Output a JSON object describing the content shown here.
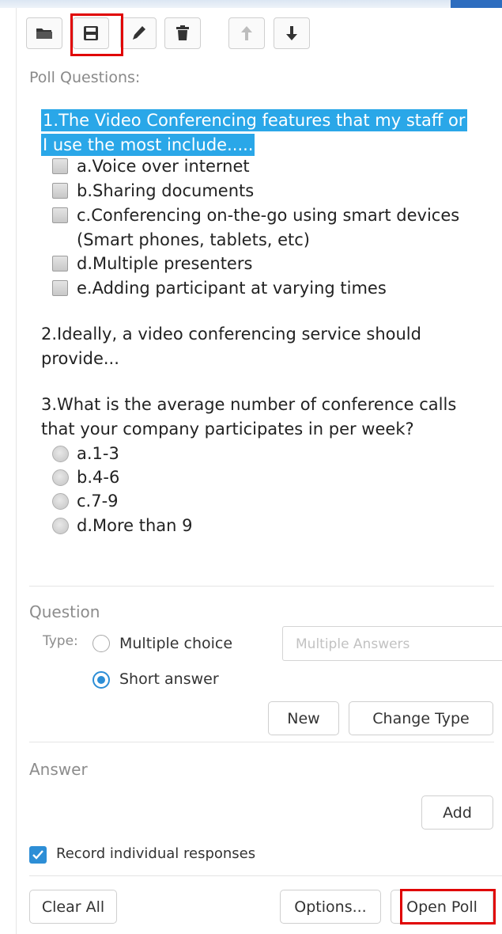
{
  "toolbar": {
    "icons": [
      "folder-open-icon",
      "save-icon",
      "pencil-icon",
      "trash-icon",
      "arrow-up-icon",
      "arrow-down-icon"
    ]
  },
  "poll": {
    "label": "Poll Questions:",
    "q1": {
      "text": "1.The Video Conferencing features that my staff or I use the most include.....",
      "options": [
        "a.Voice over internet",
        "b.Sharing documents",
        "c.Conferencing on-the-go using smart devices",
        "(Smart phones, tablets, etc)",
        "d.Multiple presenters",
        "e.Adding participant at varying times"
      ]
    },
    "q2": {
      "line1": "2.Ideally, a video conferencing service should",
      "line2": "provide..."
    },
    "q3": {
      "line1": "3.What is the average number of conference calls",
      "line2": "that your company participates in per week?",
      "options": [
        "a.1-3",
        "b.4-6",
        "c.7-9",
        "d.More than 9"
      ]
    }
  },
  "question": {
    "label": "Question",
    "type_label": "Type:",
    "multiple_choice": "Multiple choice",
    "short_answer": "Short answer",
    "selected": "Short answer",
    "placeholder": "Multiple  Answers",
    "new_button": "New",
    "change_type_button": "Change Type"
  },
  "answer": {
    "label": "Answer",
    "add_button": "Add"
  },
  "record": {
    "label": "Record individual responses",
    "checked": true
  },
  "footer": {
    "clear_all": "Clear All",
    "options": "Options...",
    "open_poll": "Open Poll"
  },
  "colors": {
    "highlight": "#2aa7e8",
    "accent": "#2d8ed6",
    "annotation_red": "#e00000"
  }
}
